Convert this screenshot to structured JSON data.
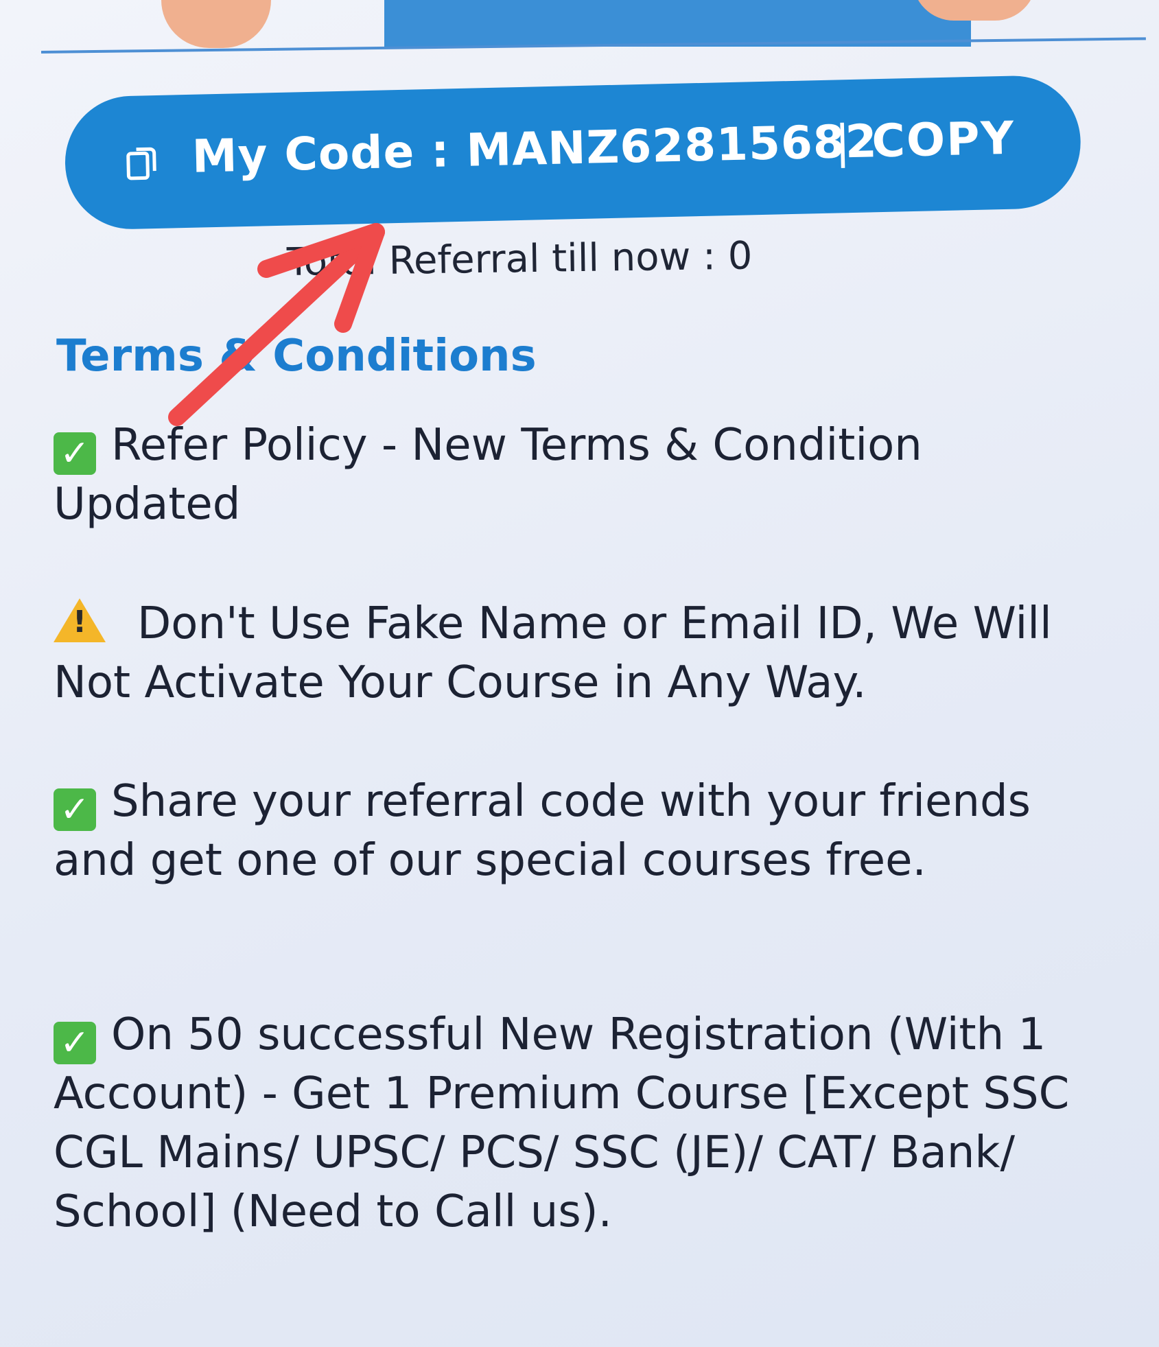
{
  "referral": {
    "code_label": "My Code : MANZ62815682",
    "separator": "|",
    "copy_label": "COPY",
    "total_referral": "Total Referral till now : 0"
  },
  "terms": {
    "heading": "Terms & Conditions",
    "items": [
      {
        "icon": "check-mark-icon",
        "text": "Refer Policy - New Terms & Condition Updated"
      },
      {
        "icon": "warning-icon",
        "text": "Don't Use Fake Name or Email ID, We Will Not Activate Your Course in Any Way."
      },
      {
        "icon": "check-mark-icon",
        "text": "Share your referral code with your friends and get one of our special courses free."
      },
      {
        "icon": "check-mark-icon",
        "text": "On 50 successful New Registration (With 1 Account) - Get 1 Premium Course [Except SSC CGL Mains/ UPSC/ PCS/ SSC (JE)/ CAT/ Bank/ School] (Need to Call us)."
      }
    ]
  },
  "colors": {
    "pill_blue": "#1d86d3",
    "heading_blue": "#1c7dcf",
    "check_green": "#4cb848",
    "warning_yellow": "#f4b629",
    "annotation_red": "#ef4b4b"
  }
}
